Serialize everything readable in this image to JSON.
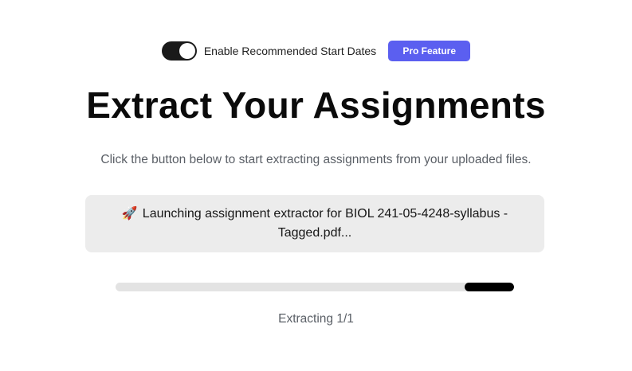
{
  "settings": {
    "toggle_label": "Enable Recommended Start Dates",
    "toggle_on": true,
    "pro_badge": "Pro Feature"
  },
  "page": {
    "title": "Extract Your Assignments",
    "subtitle": "Click the button below to start extracting assignments from your uploaded files."
  },
  "status": {
    "icon": "rocket-icon",
    "icon_glyph": "🚀",
    "message": "Launching assignment extractor for BIOL 241-05-4248-syllabus - Tagged.pdf..."
  },
  "progress": {
    "label": "Extracting 1/1"
  },
  "colors": {
    "accent": "#5b5ff0",
    "toggle_bg": "#1a1a1a",
    "status_bg": "#ececec",
    "progress_track": "#e3e3e3",
    "progress_fill": "#000000"
  }
}
